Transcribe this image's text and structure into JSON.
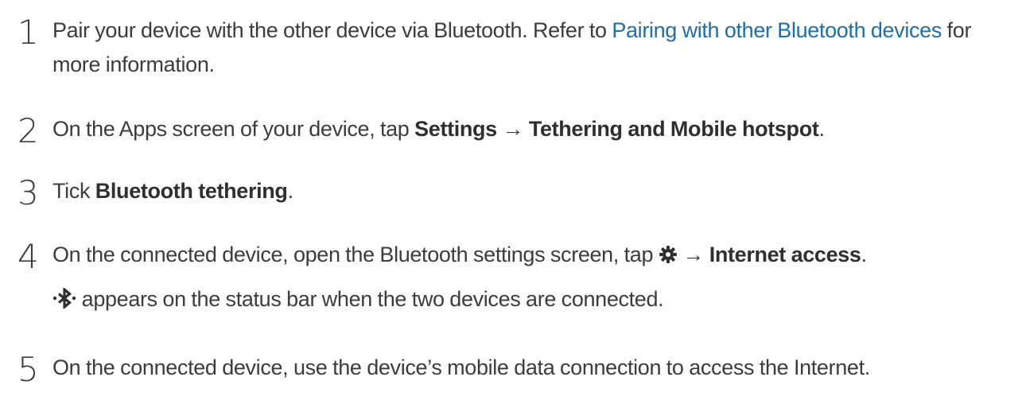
{
  "steps": [
    {
      "number": "1",
      "text_before": "Pair your device with the other device via Bluetooth. Refer to ",
      "link": "Pairing with other Bluetooth devices",
      "text_after": " for more information."
    },
    {
      "number": "2",
      "text_before": "On the Apps screen of your device, tap ",
      "bold1": "Settings",
      "arrow": " → ",
      "bold2": "Tethering and Mobile hotspot",
      "text_after": "."
    },
    {
      "number": "3",
      "text_before": "Tick ",
      "bold1": "Bluetooth tethering",
      "text_after": "."
    },
    {
      "number": "4",
      "text_before": "On the connected device, open the Bluetooth settings screen, tap ",
      "icon": "gear-icon",
      "arrow": " → ",
      "bold1": "Internet access",
      "text_after": ".",
      "note_icon": "bluetooth-tethering-icon",
      "note_text": " appears on the status bar when the two devices are connected."
    },
    {
      "number": "5",
      "text_before": "On the connected device, use the device’s mobile data connection to access the Internet."
    }
  ],
  "colors": {
    "text": "#3c3c3c",
    "link": "#1a6fb3"
  }
}
